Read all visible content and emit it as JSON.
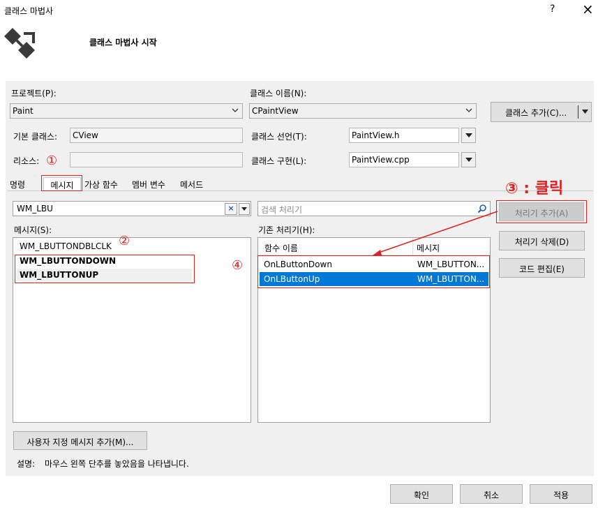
{
  "window": {
    "title": "클래스 마법사",
    "help": "?",
    "close": "×"
  },
  "header": {
    "title": "클래스 마법사 시작"
  },
  "project": {
    "label": "프로젝트(P):",
    "value": "Paint"
  },
  "class_name": {
    "label": "클래스 이름(N):",
    "value": "CPaintView"
  },
  "add_class": {
    "label": "클래스 추가(C)..."
  },
  "base_class": {
    "label": "기본 클래스:",
    "value": "CView"
  },
  "class_decl": {
    "label": "클래스 선언(T):",
    "value": "PaintView.h"
  },
  "resource": {
    "label": "리소스:",
    "value": ""
  },
  "class_impl": {
    "label": "클래스 구현(L):",
    "value": "PaintView.cpp"
  },
  "tabs": [
    {
      "label": "명령"
    },
    {
      "label": "메시지"
    },
    {
      "label": "가상 함수"
    },
    {
      "label": "멤버 변수"
    },
    {
      "label": "메서드"
    }
  ],
  "search": {
    "value": "WM_LBU",
    "handler_placeholder": "검색 처리기"
  },
  "messages": {
    "label": "메시지(S):",
    "items": [
      "WM_LBUTTONDBLCLK",
      "WM_LBUTTONDOWN",
      "WM_LBUTTONUP"
    ]
  },
  "handlers": {
    "label": "기존 처리기(H):",
    "col_function": "함수 이름",
    "col_message": "메시지",
    "rows": [
      {
        "function": "OnLButtonDown",
        "message": "WM_LBUTTON..."
      },
      {
        "function": "OnLButtonUp",
        "message": "WM_LBUTTON..."
      }
    ]
  },
  "buttons": {
    "add_handler": "처리기 추가(A)",
    "delete_handler": "처리기 삭제(D)",
    "edit_code": "코드 편집(E)",
    "add_custom": "사용자 지정 메시지 추가(M)...",
    "ok": "확인",
    "cancel": "취소",
    "apply": "적용"
  },
  "description": {
    "label": "설명:",
    "text": "마우스 왼쪽 단추를 놓았음을 나타냅니다."
  },
  "annotations": {
    "n1": "①",
    "n2": "②",
    "n3": "③ : 클릭",
    "n4": "④"
  },
  "colors": {
    "selection": "#0078d7",
    "annotation": "#e02020",
    "panel": "#f0f0f0"
  }
}
